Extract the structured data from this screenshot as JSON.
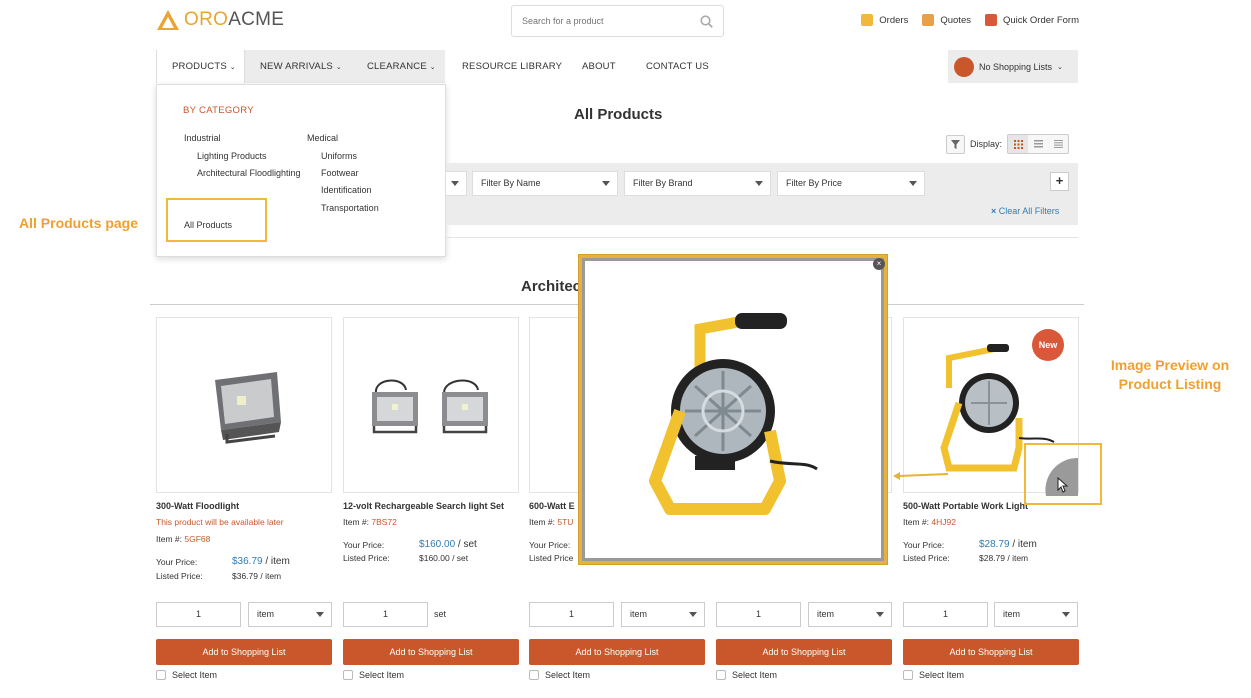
{
  "header": {
    "logo_text": "OROACME",
    "logo_accent": "ORO",
    "logo_rest": "ACME",
    "search_placeholder": "Search for a product",
    "links": [
      {
        "label": "Orders",
        "icon": "orders-icon",
        "color": "#f0b93c"
      },
      {
        "label": "Quotes",
        "icon": "quotes-icon",
        "color": "#e8a04a"
      },
      {
        "label": "Quick Order Form",
        "icon": "quick-order-icon",
        "color": "#d9583a"
      }
    ]
  },
  "nav": {
    "items": [
      "PRODUCTS",
      "NEW ARRIVALS",
      "CLEARANCE",
      "RESOURCE LIBRARY",
      "ABOUT",
      "CONTACT US"
    ],
    "shopping_lists": "No Shopping Lists"
  },
  "dropdown": {
    "title": "BY CATEGORY",
    "col1_title": "Industrial",
    "col1_items": [
      "Lighting Products",
      "Architectural Floodlighting"
    ],
    "col2_title": "Medical",
    "col2_items": [
      "Uniforms",
      "Footwear",
      "Identification",
      "Transportation"
    ],
    "all_products": "All Products"
  },
  "annotations": {
    "left": "All Products page",
    "right": "Image Preview on Product Listing"
  },
  "page": {
    "title": "All Products",
    "section_title": "Architec",
    "display_label": "Display:"
  },
  "filters": {
    "items": [
      "",
      "Filter By Name",
      "Filter By Brand",
      "Filter By Price"
    ],
    "clear_all": "Clear All Filters",
    "add": "+"
  },
  "products": [
    {
      "name": "300-Watt Floodlight",
      "availability": "This product will be available later",
      "item_label": "Item #:",
      "item_no": "5GF68",
      "your_price_label": "Your Price:",
      "your_price": "$36.79",
      "your_unit": " / item",
      "listed_label": "Listed Price:",
      "listed_price": "$36.79 / item",
      "qty": "1",
      "unit": "item",
      "add_label": "Add to Shopping List",
      "select_label": "Select Item"
    },
    {
      "name": "12-volt Rechargeable Search light Set",
      "item_label": "Item #:",
      "item_no": "7BS72",
      "your_price_label": "Your Price:",
      "your_price": "$160.00",
      "your_unit": " / set",
      "listed_label": "Listed Price:",
      "listed_price": "$160.00 / set",
      "qty": "1",
      "unit": "set",
      "add_label": "Add to Shopping List",
      "select_label": "Select Item"
    },
    {
      "name": "600-Watt E",
      "item_label": "Item #:",
      "item_no": "5TU",
      "your_price_label": "Your Price:",
      "listed_label": "Listed Price",
      "qty": "1",
      "unit": "item",
      "add_label": "Add to Shopping List",
      "select_label": "Select Item"
    },
    {
      "qty": "1",
      "unit": "item",
      "add_label": "Add to Shopping List",
      "select_label": "Select Item"
    },
    {
      "name": "500-Watt Portable Work Light",
      "item_label": "Item #:",
      "item_no": "4HJ92",
      "your_price_label": "Your Price:",
      "your_price": "$28.79",
      "your_unit": " / item",
      "listed_label": "Listed Price:",
      "listed_price": "$28.79 / item",
      "qty": "1",
      "unit": "item",
      "add_label": "Add to Shopping List",
      "select_label": "Select Item",
      "badge": "New"
    }
  ],
  "preview": {
    "close": "×"
  },
  "colors": {
    "accent": "#c9572b",
    "highlight": "#f0b93c",
    "link": "#2f7db7"
  }
}
